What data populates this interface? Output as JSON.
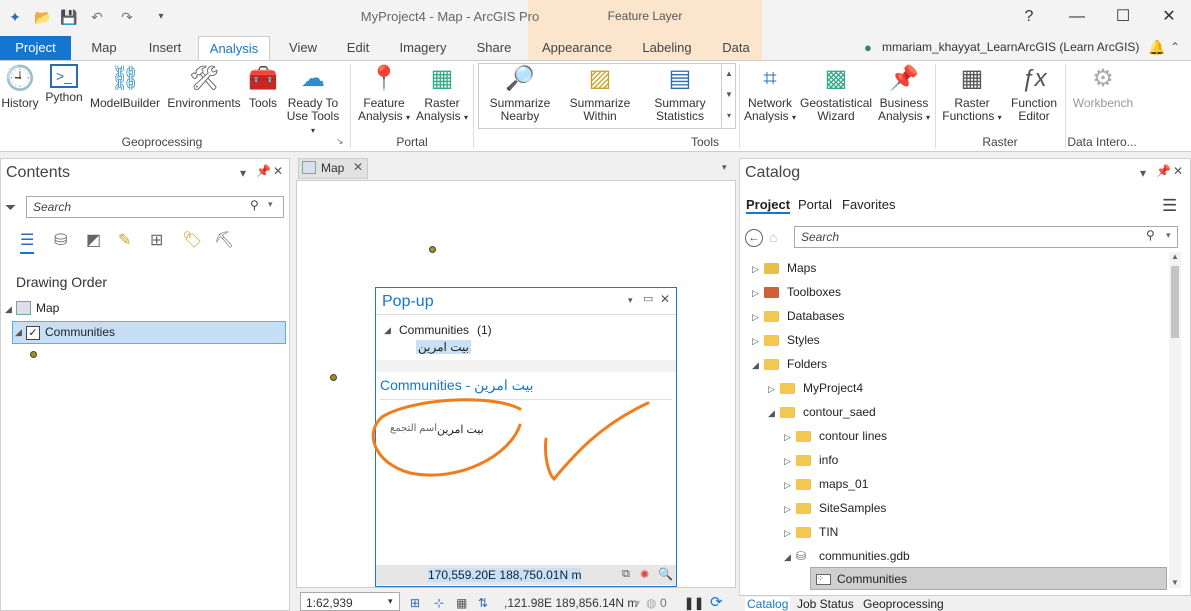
{
  "title_bar": {
    "app_title": "MyProject4 - Map - ArcGIS Pro",
    "contextual_tab": "Feature Layer",
    "help": "?",
    "minimize": "—",
    "maximize": "☐",
    "close": "✕"
  },
  "tabs": [
    "Project",
    "Map",
    "Insert",
    "Analysis",
    "View",
    "Edit",
    "Imagery",
    "Share",
    "Appearance",
    "Labeling",
    "Data"
  ],
  "user": "mmariam_khayyat_LearnArcGIS (Learn ArcGIS)",
  "ribbon": {
    "geoprocessing": {
      "label": "Geoprocessing",
      "buttons": [
        "History",
        "Python",
        "ModelBuilder",
        "Environments",
        "Tools",
        "Ready To",
        "Use Tools"
      ]
    },
    "portal": {
      "label": "Portal",
      "feature_analysis": [
        "Feature",
        "Analysis"
      ],
      "raster_analysis": [
        "Raster",
        "Analysis"
      ]
    },
    "tools": {
      "label": "Tools",
      "gallery": [
        [
          "Summarize",
          "Nearby"
        ],
        [
          "Summarize",
          "Within"
        ],
        [
          "Summary",
          "Statistics"
        ]
      ],
      "network_analysis": [
        "Network",
        "Analysis"
      ],
      "geostatistical": [
        "Geostatistical",
        "Wizard"
      ],
      "business_analysis": [
        "Business",
        "Analysis"
      ]
    },
    "raster": {
      "label": "Raster",
      "raster_functions": [
        "Raster",
        "Functions"
      ],
      "function_editor": [
        "Function",
        "Editor"
      ]
    },
    "data_interop": {
      "label": "Data Intero...",
      "workbench": "Workbench"
    }
  },
  "contents": {
    "title": "Contents",
    "search_placeholder": "Search",
    "drawing_order": "Drawing Order",
    "map_label": "Map",
    "layer_label": "Communities"
  },
  "map_tab": {
    "label": "Map",
    "scale": "1:62,939",
    "coords": ",121.98E 189,856.14N m",
    "selected_count": "0"
  },
  "popup": {
    "title": "Pop-up",
    "group": "Communities",
    "group_count": "(1)",
    "feature": "بيت امرين",
    "subtitle": "Communities - بيت امرين",
    "field_label": "اسم التجمع",
    "field_value": "بيت امرين",
    "coords": "170,559.20E 188,750.01N m"
  },
  "catalog": {
    "title": "Catalog",
    "tabs": [
      "Project",
      "Portal",
      "Favorites"
    ],
    "search_placeholder": "Search",
    "items": {
      "maps": "Maps",
      "toolboxes": "Toolboxes",
      "databases": "Databases",
      "styles": "Styles",
      "folders": "Folders",
      "myproject": "MyProject4",
      "contour_saed": "contour_saed",
      "contour_lines": "contour lines",
      "info": "info",
      "maps01": "maps_01",
      "site_samples": "SiteSamples",
      "tin": "TIN",
      "communities_gdb": "communities.gdb",
      "communities": "Communities"
    },
    "bottom_tabs": [
      "Catalog",
      "Job Status",
      "Geoprocessing"
    ]
  },
  "colors": {
    "accent": "#1576d2",
    "annotation": "#f07c1c"
  }
}
